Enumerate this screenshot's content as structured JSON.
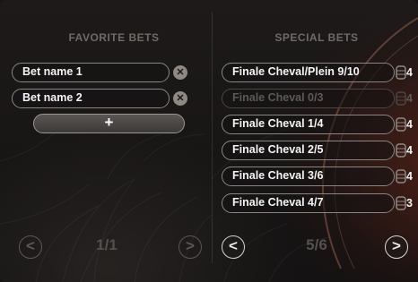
{
  "favorite_bets": {
    "title": "FAVORITE BETS",
    "items": [
      {
        "name": "Bet name 1",
        "remove_icon": "close-icon"
      },
      {
        "name": "Bet name 2",
        "remove_icon": "close-icon"
      }
    ],
    "add_label": "+",
    "pagination": {
      "prev_label": "<",
      "page": "1/1",
      "next_label": ">"
    }
  },
  "special_bets": {
    "title": "SPECIAL BETS",
    "items": [
      {
        "name": "Finale Cheval/Plein 9/10",
        "chips": "4",
        "enabled": true
      },
      {
        "name": "Finale Cheval 0/3",
        "chips": "4",
        "enabled": false
      },
      {
        "name": "Finale Cheval 1/4",
        "chips": "4",
        "enabled": true
      },
      {
        "name": "Finale Cheval 2/5",
        "chips": "4",
        "enabled": true
      },
      {
        "name": "Finale Cheval 3/6",
        "chips": "4",
        "enabled": true
      },
      {
        "name": "Finale Cheval 4/7",
        "chips": "3",
        "enabled": true
      }
    ],
    "pagination": {
      "prev_label": "<",
      "page": "5/6",
      "next_label": ">"
    }
  },
  "colors": {
    "text": "#f4f4f4",
    "dim_text": "#5e5955",
    "title": "#6f6a66",
    "pill_border": "#8a8580"
  }
}
